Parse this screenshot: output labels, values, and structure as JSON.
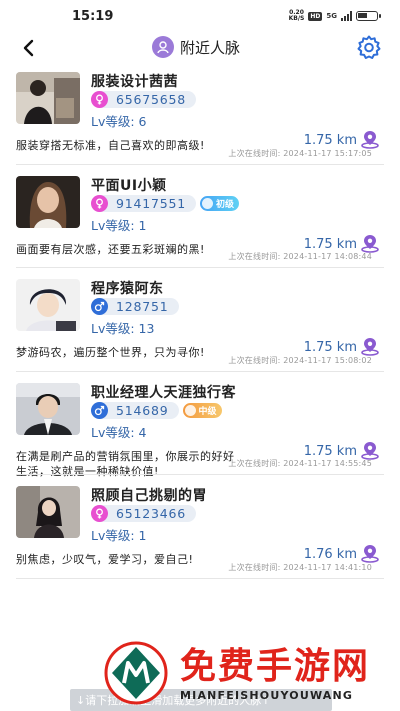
{
  "status_bar": {
    "time": "15:19",
    "net_speed": "0.20",
    "net_unit": "KB/S",
    "hd": "HD",
    "network": "5G"
  },
  "header": {
    "title": "附近人脉",
    "back_icon": "chevron-left-icon",
    "title_icon": "person-icon",
    "settings_icon": "gear-icon"
  },
  "users": [
    {
      "name": "服装设计茜茜",
      "gender": "female",
      "id": "65675658",
      "badge": "",
      "level": "Lv等级: 6",
      "bio": "服装穿搭无标准，自己喜欢的即高级!",
      "distance": "1.75 km",
      "last_online": "上次在线时间: 2024-11-17 15:17:05"
    },
    {
      "name": "平面UI小颖",
      "gender": "female",
      "id": "91417551",
      "badge": "初级",
      "level": "Lv等级: 1",
      "bio": "画面要有层次感，还要五彩斑斓的黑!",
      "distance": "1.75 km",
      "last_online": "上次在线时间: 2024-11-17 14:08:44"
    },
    {
      "name": "程序猿阿东",
      "gender": "male",
      "id": "128751",
      "badge": "",
      "level": "Lv等级: 13",
      "bio": "梦游码农，遍历整个世界，只为寻你!",
      "distance": "1.75 km",
      "last_online": "上次在线时间: 2024-11-17 15:08:02"
    },
    {
      "name": "职业经理人天涯独行客",
      "gender": "male",
      "id": "514689",
      "badge": "中级",
      "level": "Lv等级: 4",
      "bio": "在满是刷产品的营销氛围里，你展示的好好生活，这就是一种稀缺价值!",
      "distance": "1.75 km",
      "last_online": "上次在线时间: 2024-11-17 14:55:45"
    },
    {
      "name": "照顾自己挑剔的胃",
      "gender": "female",
      "id": "65123466",
      "badge": "",
      "level": "Lv等级: 1",
      "bio": "别焦虑，少叹气，爱学习，爱自己!",
      "distance": "1.76 km",
      "last_online": "上次在线时间: 2024-11-17 14:41:10"
    }
  ],
  "footer": {
    "load_hint": "↓请下拉加载上滑加载更多附近的人脉↑"
  },
  "watermark": {
    "text": "免费手游网",
    "sub": "MIANFEISHOUYOUWANG"
  },
  "colors": {
    "accent_blue": "#3566a8",
    "female": "#e84fd0",
    "male": "#2f6ed8",
    "title_icon": "#9b7ad8",
    "location_icon": "#8a5ad0",
    "watermark_red": "#e0241b"
  }
}
